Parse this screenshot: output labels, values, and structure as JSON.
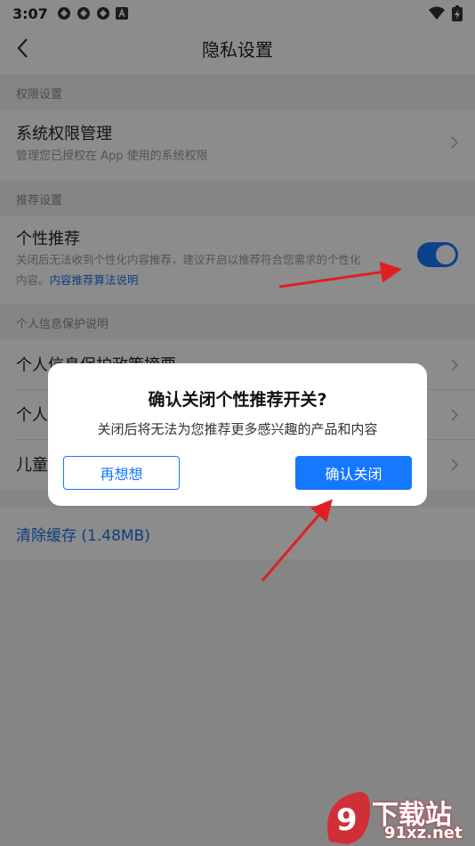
{
  "status_bar": {
    "time": "3:07"
  },
  "nav": {
    "title": "隐私设置"
  },
  "sections": {
    "permissions": {
      "header": "权限设置",
      "item_title": "系统权限管理",
      "item_subtitle": "管理您已授权在 App 使用的系统权限"
    },
    "recommend": {
      "header": "推荐设置",
      "item_title": "个性推荐",
      "item_desc_line1": "关闭后无法收到个性化内容推荐，建议开启以推荐符合您需求的个性化",
      "item_desc_line2_prefix": "内容。",
      "item_desc_link": "内容推荐算法说明",
      "toggle_on": true
    },
    "privacy_info": {
      "header": "个人信息保护说明",
      "items": [
        "个人信息保护政策摘要",
        "个人",
        "儿童"
      ]
    }
  },
  "cache": {
    "label": "清除缓存 (1.48MB)"
  },
  "dialog": {
    "title": "确认关闭个性推荐开关?",
    "message": "关闭后将无法为您推荐更多感兴趣的产品和内容",
    "cancel_label": "再想想",
    "confirm_label": "确认关闭"
  },
  "watermark": {
    "text": "下载站",
    "url": "91xz.net"
  },
  "colors": {
    "accent": "#1677ff",
    "arrow": "#e02020",
    "overlay": "rgba(0,0,0,0.45)"
  }
}
